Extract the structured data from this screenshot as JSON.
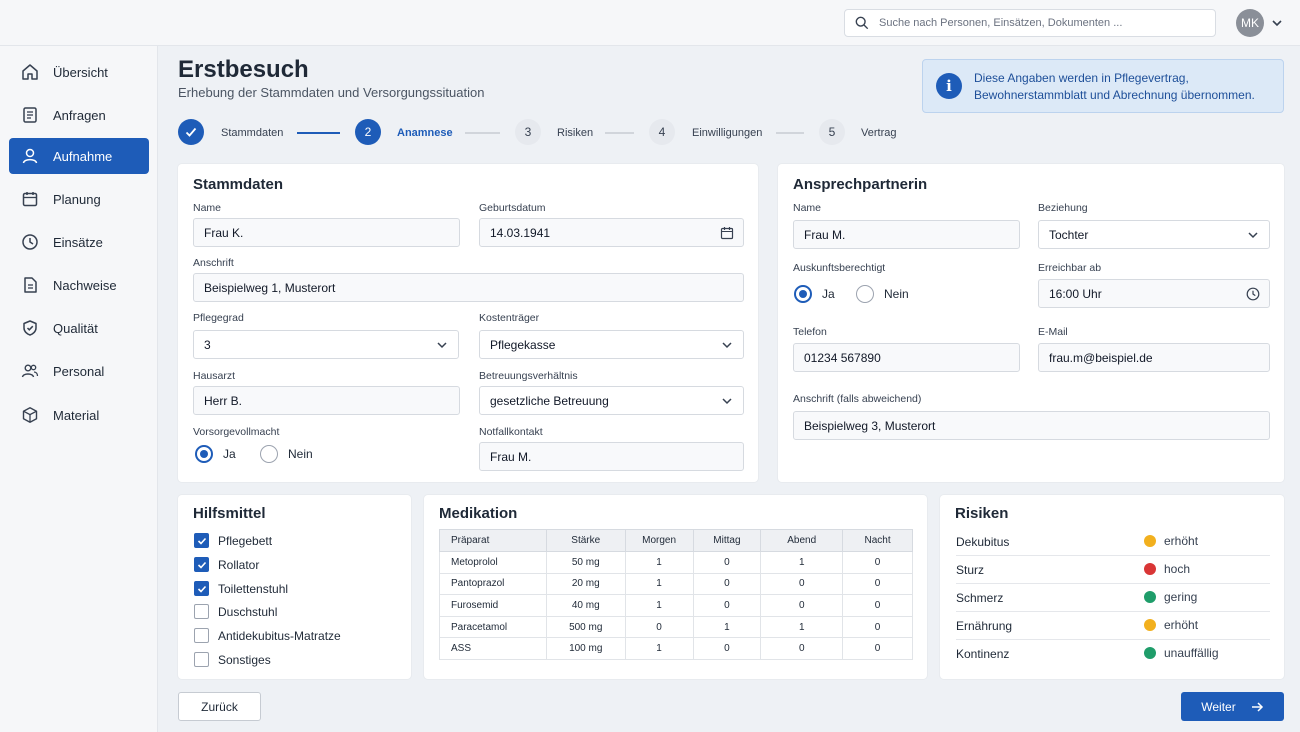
{
  "search": {
    "placeholder": "Suche nach Personen, Einsätzen, Dokumenten ..."
  },
  "user": {
    "initials": "MK"
  },
  "sidebar": {
    "items": [
      {
        "label": "Übersicht",
        "icon": "home-icon"
      },
      {
        "label": "Anfragen",
        "icon": "document-list-icon"
      },
      {
        "label": "Aufnahme",
        "icon": "user-icon",
        "active": true
      },
      {
        "label": "Planung",
        "icon": "calendar-icon"
      },
      {
        "label": "Einsätze",
        "icon": "clock-icon"
      },
      {
        "label": "Nachweise",
        "icon": "file-icon"
      },
      {
        "label": "Qualität",
        "icon": "shield-check-icon"
      },
      {
        "label": "Personal",
        "icon": "users-icon"
      },
      {
        "label": "Material",
        "icon": "box-icon"
      }
    ]
  },
  "header": {
    "title": "Erstbesuch",
    "subtitle": "Erhebung der Stammdaten und Versorgungssituation"
  },
  "info": {
    "line1": "Diese Angaben werden in Pflegevertrag,",
    "line2": "Bewohnerstammblatt und  Abrechnung übernommen."
  },
  "stepper": {
    "steps": [
      {
        "number": "1",
        "label": "Stammdaten",
        "state": "done"
      },
      {
        "number": "2",
        "label": "Anamnese",
        "state": "current"
      },
      {
        "number": "3",
        "label": "Risiken",
        "state": "todo"
      },
      {
        "number": "4",
        "label": "Einwilligungen",
        "state": "todo"
      },
      {
        "number": "5",
        "label": "Vertrag",
        "state": "todo"
      }
    ]
  },
  "stammdaten": {
    "title": "Stammdaten",
    "name_label": "Name",
    "name_value": "Frau K.",
    "geburtsdatum_label": "Geburtsdatum",
    "geburtsdatum_value": "14.03.1941",
    "anschrift_label": "Anschrift",
    "anschrift_value": "Beispielweg 1, Musterort",
    "pflegegrad_label": "Pflegegrad",
    "pflegegrad_value": "3",
    "kostentraeger_label": "Kostenträger",
    "kostentraeger_value": "Pflegekasse",
    "hausarzt_label": "Hausarzt",
    "hausarzt_value": "Herr B.",
    "betreuung_label": "Betreuungsverhältnis",
    "betreuung_value": "gesetzliche Betreuung",
    "vorsorge_label": "Vorsorgevollmacht",
    "vorsorge_ja": "Ja",
    "vorsorge_nein": "Nein",
    "vorsorge_selected": "Ja",
    "notfall_label": "Notfallkontakt",
    "notfall_value": "Frau M."
  },
  "ansprechpartnerin": {
    "title": "Ansprechpartnerin",
    "name_label": "Name",
    "name_value": "Frau M.",
    "beziehung_label": "Beziehung",
    "beziehung_value": "Tochter",
    "auskunft_label": "Auskunftsberechtigt",
    "auskunft_ja": "Ja",
    "auskunft_nein": "Nein",
    "auskunft_selected": "Ja",
    "erreichbar_label": "Erreichbar ab",
    "erreichbar_value": "16:00 Uhr",
    "telefon_label": "Telefon",
    "telefon_value": "01234 567890",
    "email_label": "E-Mail",
    "email_value": "frau.m@beispiel.de",
    "anschrift_label": "Anschrift (falls abweichend)",
    "anschrift_value": "Beispielweg 3, Musterort"
  },
  "hilfsmittel": {
    "title": "Hilfsmittel",
    "items": [
      {
        "label": "Pflegebett",
        "checked": true
      },
      {
        "label": "Rollator",
        "checked": true
      },
      {
        "label": "Toilettenstuhl",
        "checked": true
      },
      {
        "label": "Duschstuhl",
        "checked": false
      },
      {
        "label": "Antidekubitus-Matratze",
        "checked": false
      },
      {
        "label": "Sonstiges",
        "checked": false
      }
    ]
  },
  "medikation": {
    "title": "Medikation",
    "columns": [
      "Präparat",
      "Stärke",
      "Morgen",
      "Mittag",
      "Abend",
      "Nacht"
    ],
    "rows": [
      [
        "Metoprolol",
        "50 mg",
        "1",
        "0",
        "1",
        "0"
      ],
      [
        "Pantoprazol",
        "20 mg",
        "1",
        "0",
        "0",
        "0"
      ],
      [
        "Furosemid",
        "40 mg",
        "1",
        "0",
        "0",
        "0"
      ],
      [
        "Paracetamol",
        "500 mg",
        "0",
        "1",
        "1",
        "0"
      ],
      [
        "ASS",
        "100 mg",
        "1",
        "0",
        "0",
        "0"
      ]
    ]
  },
  "risiken": {
    "title": "Risiken",
    "items": [
      {
        "name": "Dekubitus",
        "level": "erhöht",
        "color": "#f2b01e"
      },
      {
        "name": "Sturz",
        "level": "hoch",
        "color": "#d93636"
      },
      {
        "name": "Schmerz",
        "level": "gering",
        "color": "#1f9d6a"
      },
      {
        "name": "Ernährung",
        "level": "erhöht",
        "color": "#f2b01e"
      },
      {
        "name": "Kontinenz",
        "level": "unauffällig",
        "color": "#1f9d6a"
      }
    ]
  },
  "buttons": {
    "back": "Zurück",
    "next": "Weiter"
  },
  "colors": {
    "primary": "#1e5cb8",
    "info_bg": "#dce9f7"
  }
}
